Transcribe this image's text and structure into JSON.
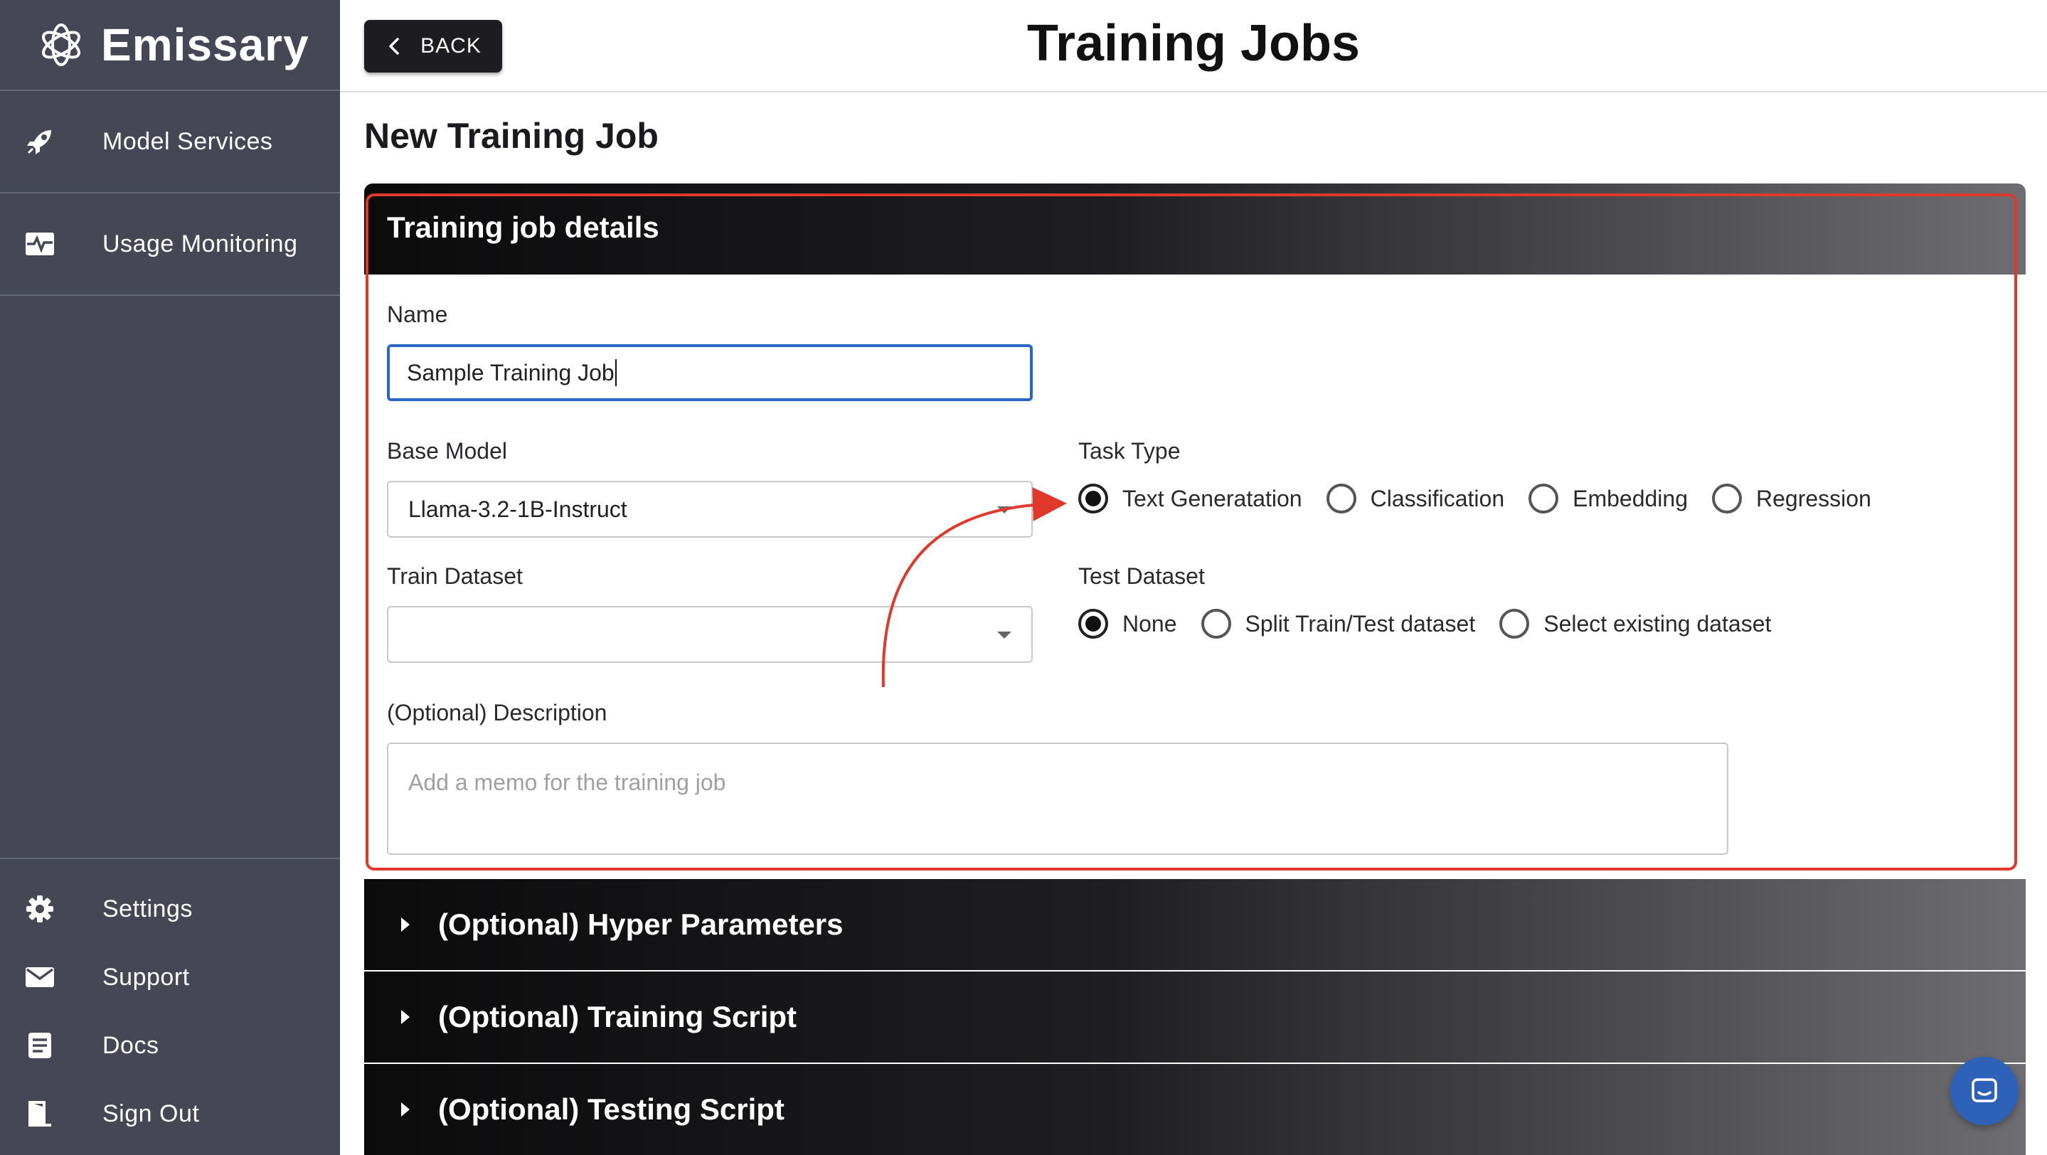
{
  "brand": {
    "name": "Emissary"
  },
  "sidebar": {
    "items": [
      {
        "label": "Model Services",
        "icon": "rocket-icon"
      },
      {
        "label": "Usage Monitoring",
        "icon": "pulse-monitor-icon"
      }
    ],
    "bottom_items": [
      {
        "label": "Settings",
        "icon": "gear-icon"
      },
      {
        "label": "Support",
        "icon": "mail-icon"
      },
      {
        "label": "Docs",
        "icon": "document-icon"
      },
      {
        "label": "Sign Out",
        "icon": "door-exit-icon"
      }
    ]
  },
  "header": {
    "back_label": "BACK",
    "title": "Training Jobs"
  },
  "main": {
    "section_title": "New Training Job",
    "card_title": "Training job details",
    "name": {
      "label": "Name",
      "value": "Sample Training Job"
    },
    "base_model": {
      "label": "Base Model",
      "value": "Llama-3.2-1B-Instruct"
    },
    "train_dataset": {
      "label": "Train Dataset",
      "value": ""
    },
    "description": {
      "label": "(Optional) Description",
      "placeholder": "Add a memo for the training job"
    },
    "task_type": {
      "label": "Task Type",
      "options": [
        "Text Generatation",
        "Classification",
        "Embedding",
        "Regression"
      ],
      "selected": "Text Generatation"
    },
    "test_dataset": {
      "label": "Test Dataset",
      "options": [
        "None",
        "Split Train/Test dataset",
        "Select existing dataset"
      ],
      "selected": "None"
    },
    "accordions": [
      "(Optional) Hyper Parameters",
      "(Optional) Training Script",
      "(Optional) Testing Script"
    ]
  },
  "colors": {
    "sidebar_bg": "#454754",
    "highlight": "#e0392b",
    "input_focus": "#2a66c8",
    "chat_button": "#2d62b8"
  }
}
